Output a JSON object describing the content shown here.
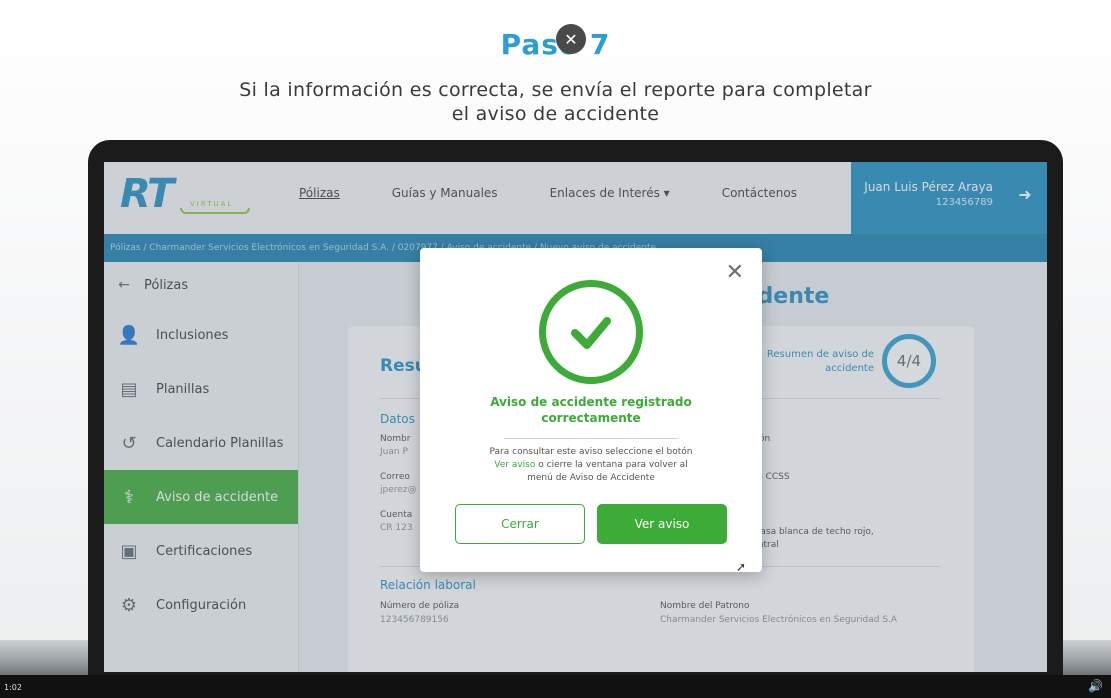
{
  "slide": {
    "title": "Paso 7",
    "subtitle_line1": "Si la información es correcta, se envía el reporte para completar",
    "subtitle_line2": "el aviso de accidente"
  },
  "app": {
    "logo_text": "RT",
    "logo_sub": "VIRTUAL",
    "nav": {
      "polizas": "Pólizas",
      "guias": "Guías y Manuales",
      "enlaces": "Enlaces de Interés ▾",
      "contacto": "Contáctenos"
    },
    "user": {
      "name": "Juan Luis Pérez Araya",
      "id": "123456789"
    },
    "breadcrumb": "Pólizas / Charmander Servicios Electrónicos en Seguridad S.A. / 0207977 / Aviso de accidente / Nuevo aviso de accidente",
    "sidebar": {
      "back": "Pólizas",
      "items": [
        {
          "label": "Inclusiones",
          "icon": "user-plus-icon"
        },
        {
          "label": "Planillas",
          "icon": "document-icon"
        },
        {
          "label": "Calendario Planillas",
          "icon": "history-icon"
        },
        {
          "label": "Aviso de accidente",
          "icon": "injury-icon"
        },
        {
          "label": "Certificaciones",
          "icon": "certificate-icon"
        },
        {
          "label": "Configuración",
          "icon": "gear-icon"
        }
      ]
    },
    "main": {
      "title_partial": "idente",
      "card_title_partial": "Resu",
      "progress_label": "Resumen de aviso de accidente",
      "progress_value": "4/4",
      "section_datos": "Datos",
      "f1_label": "Nombr",
      "f1_value": "Juan P",
      "f2_label": "Correo",
      "f2_value": "jperez@",
      "f3_label": "Cuenta",
      "f3_value": "CR 123",
      "r1_label": "ación",
      "r2_label": "ado CCSS",
      "r3_value": "r, casa blanca de techo rojo,",
      "r3_value2": "Central",
      "section_relacion": "Relación laboral",
      "poliza_label": "Número de póliza",
      "poliza_value": "123456789156",
      "patrono_label": "Nombre del Patrono",
      "patrono_value": "Charmander Servicios Electrónicos en Seguridad S.A"
    },
    "modal": {
      "title_line1": "Aviso de accidente registrado",
      "title_line2": "correctamente",
      "desc_1": "Para consultar este aviso seleccione el botón",
      "desc_link": "Ver aviso",
      "desc_2": "o cierre la ventana para volver al",
      "desc_3": "menú de Aviso de Accidente",
      "cancel": "Cerrar",
      "view": "Ver aviso"
    }
  },
  "video": {
    "time": "1:02"
  },
  "colors": {
    "brand_blue": "#1f8fc2",
    "brand_green": "#3cab38"
  }
}
